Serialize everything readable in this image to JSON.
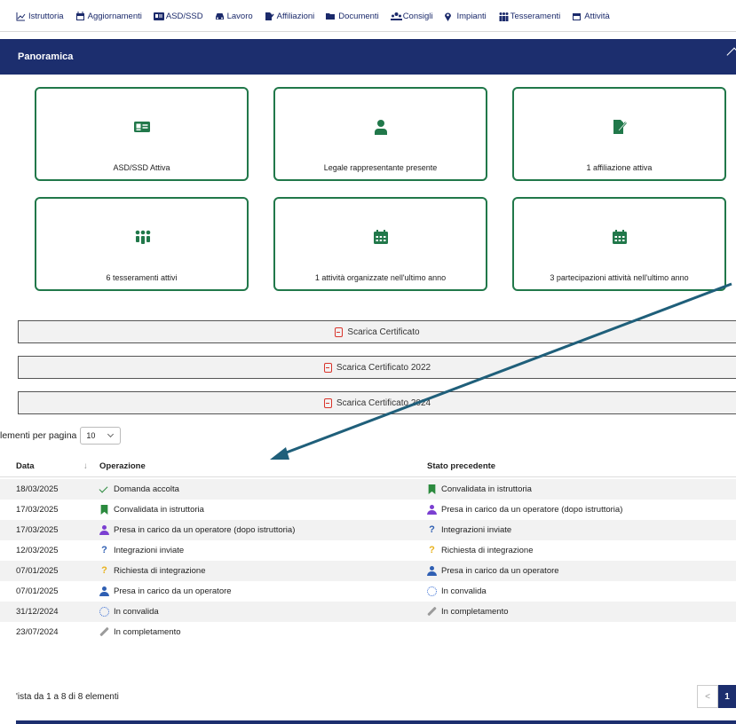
{
  "tabs": [
    {
      "label": "Istruttoria",
      "icon": "chart-line-icon",
      "active": true
    },
    {
      "label": "Aggiornamenti",
      "icon": "calendar-icon"
    },
    {
      "label": "ASD/SSD",
      "icon": "id-card-icon"
    },
    {
      "label": "Lavoro",
      "icon": "car-icon"
    },
    {
      "label": "Affiliazioni",
      "icon": "signature-icon"
    },
    {
      "label": "Documenti",
      "icon": "folder-icon"
    },
    {
      "label": "Consigli",
      "icon": "people-icon"
    },
    {
      "label": "Impianti",
      "icon": "map-marker-icon"
    },
    {
      "label": "Tesseramenti",
      "icon": "users-icon"
    },
    {
      "label": "Attività",
      "icon": "calendar-icon"
    }
  ],
  "panorama": {
    "title": "Panoramica"
  },
  "cards": [
    {
      "label": "ASD/SSD Attiva",
      "icon": "id-card-icon"
    },
    {
      "label": "Legale rappresentante presente",
      "icon": "user-icon"
    },
    {
      "label": "1 affiliazione attiva",
      "icon": "signature-icon"
    },
    {
      "label": "6 tesseramenti attivi",
      "icon": "users-icon"
    },
    {
      "label": "1 attività organizzate nell'ultimo anno",
      "icon": "calendar-icon"
    },
    {
      "label": "3 partecipazioni attività nell'ultimo anno",
      "icon": "calendar-icon"
    }
  ],
  "downloads": [
    {
      "label": "Scarica Certificato"
    },
    {
      "label": "Scarica Certificato 2022"
    },
    {
      "label": "Scarica Certificato 2024"
    }
  ],
  "page_size": {
    "label": "lementi per pagina",
    "value": "10"
  },
  "table": {
    "headers": {
      "date": "Data",
      "operation": "Operazione",
      "previous": "Stato precedente"
    },
    "rows": [
      {
        "date": "18/03/2025",
        "op": "Domanda accolta",
        "op_icon": "check-icon",
        "prev": "Convalidata in istruttoria",
        "prev_icon": "bookmark-icon"
      },
      {
        "date": "17/03/2025",
        "op": "Convalidata in istruttoria",
        "op_icon": "bookmark-icon",
        "prev": "Presa in carico da un operatore (dopo istruttoria)",
        "prev_icon": "user-purple-icon"
      },
      {
        "date": "17/03/2025",
        "op": "Presa in carico da un operatore (dopo istruttoria)",
        "op_icon": "user-purple-icon",
        "prev": "Integrazioni inviate",
        "prev_icon": "question-blue-icon"
      },
      {
        "date": "12/03/2025",
        "op": "Integrazioni inviate",
        "op_icon": "question-blue-icon",
        "prev": "Richiesta di integrazione",
        "prev_icon": "question-yellow-icon"
      },
      {
        "date": "07/01/2025",
        "op": "Richiesta di integrazione",
        "op_icon": "question-yellow-icon",
        "prev": "Presa in carico da un operatore",
        "prev_icon": "user-blue-icon"
      },
      {
        "date": "07/01/2025",
        "op": "Presa in carico da un operatore",
        "op_icon": "user-blue-icon",
        "prev": "In convalida",
        "prev_icon": "spinner-icon"
      },
      {
        "date": "31/12/2024",
        "op": "In convalida",
        "op_icon": "spinner-icon",
        "prev": "In completamento",
        "prev_icon": "pencil-icon"
      },
      {
        "date": "23/07/2024",
        "op": "In completamento",
        "op_icon": "pencil-icon",
        "prev": "",
        "prev_icon": ""
      }
    ]
  },
  "pagination": {
    "info": "'ista da 1 a 8 di 8 elementi",
    "prev": "<",
    "current": "1"
  },
  "colors": {
    "primary": "#1c2e6e",
    "card_border": "#21784a",
    "pdf": "#d9342b",
    "arrow": "#1f5f7a"
  }
}
